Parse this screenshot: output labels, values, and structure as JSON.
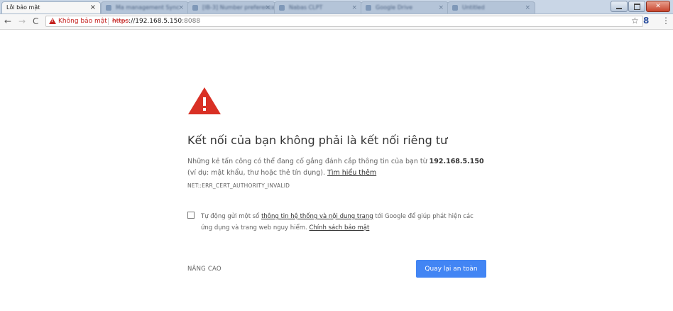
{
  "tabs": {
    "active": {
      "title": "Lỗi bảo mật",
      "close": "×"
    },
    "background": [
      {
        "title": "Ma management Sync"
      },
      {
        "title": "[IB-3] Number preferences"
      },
      {
        "title": "Nabas CLPT"
      },
      {
        "title": "Google Drive"
      },
      {
        "title": "Untitled"
      }
    ]
  },
  "toolbar": {
    "back": "←",
    "forward": "→",
    "reload": "C",
    "security_label": "Không bảo mật",
    "url_scheme": "https",
    "url_host": "://192.168.5.150",
    "url_port": ":8088",
    "bookmark": "☆",
    "extension": "8",
    "menu": "⋮"
  },
  "interstitial": {
    "heading": "Kết nối của bạn không phải là kết nối riêng tư",
    "para_before": "Những kẻ tấn công có thể đang cố gắng đánh cắp thông tin của bạn từ ",
    "host": "192.168.5.150",
    "para_after": " (ví dụ: mật khẩu, thư hoặc thẻ tín dụng). ",
    "learn_more": "Tìm hiểu thêm",
    "error_code": "NET::ERR_CERT_AUTHORITY_INVALID",
    "optin_before": "Tự động gửi một số ",
    "optin_link": "thông tin hệ thống và nội dung trang",
    "optin_after": " tới Google để giúp phát hiện các ứng dụng và trang web nguy hiểm. ",
    "privacy_link": "Chính sách bảo mật",
    "advanced": "NÂNG CAO",
    "back_to_safety": "Quay lại an toàn"
  },
  "colors": {
    "danger": "#c5221f",
    "primary_button": "#4285f4",
    "text": "#646464"
  }
}
